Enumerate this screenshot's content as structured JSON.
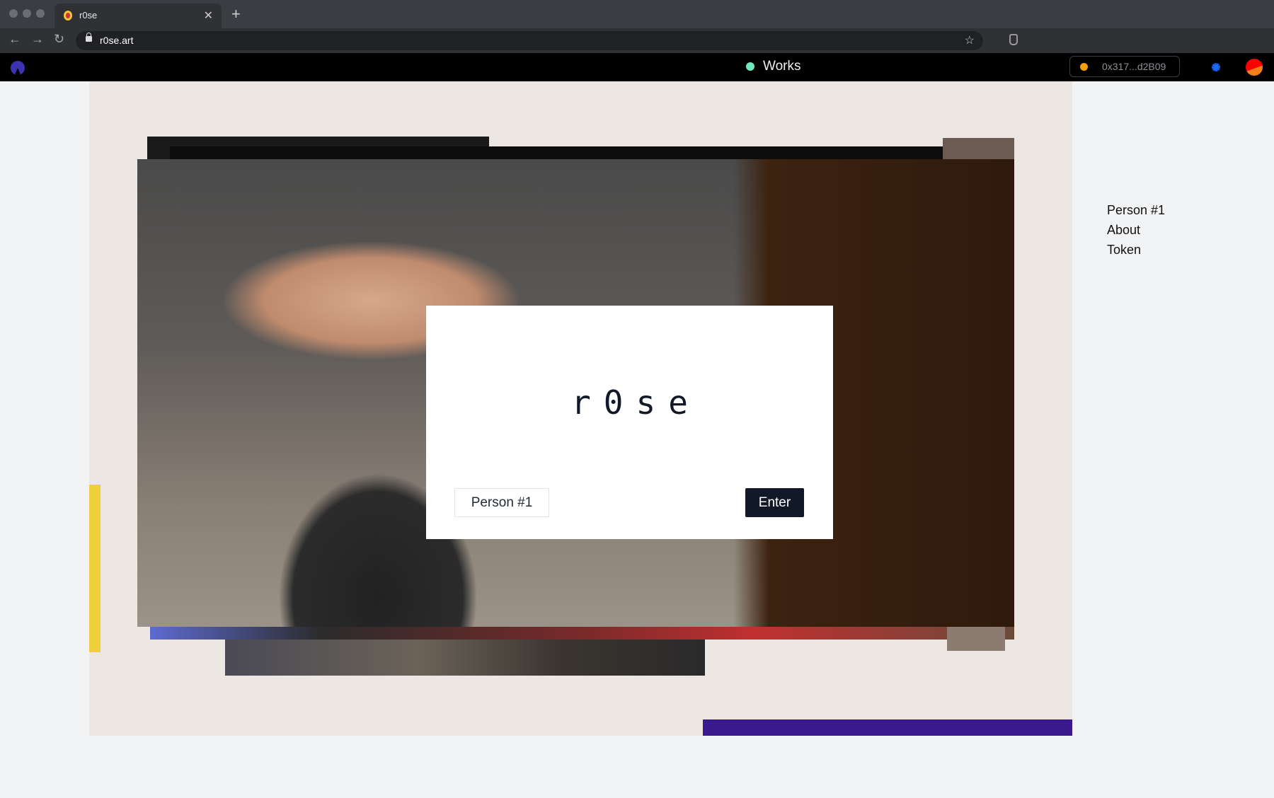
{
  "browser": {
    "tab_title": "r0se",
    "url": "r0se.art"
  },
  "appbar": {
    "works_label": "Works",
    "wallet_address": "0x317...d2B09",
    "status_color": "#6ee7c0",
    "wallet_dot_color": "#f59e0b"
  },
  "modal": {
    "brand": "r0se",
    "person_button": "Person #1",
    "enter_button": "Enter"
  },
  "menu": {
    "items": [
      "Person #1",
      "About",
      "Token"
    ]
  }
}
